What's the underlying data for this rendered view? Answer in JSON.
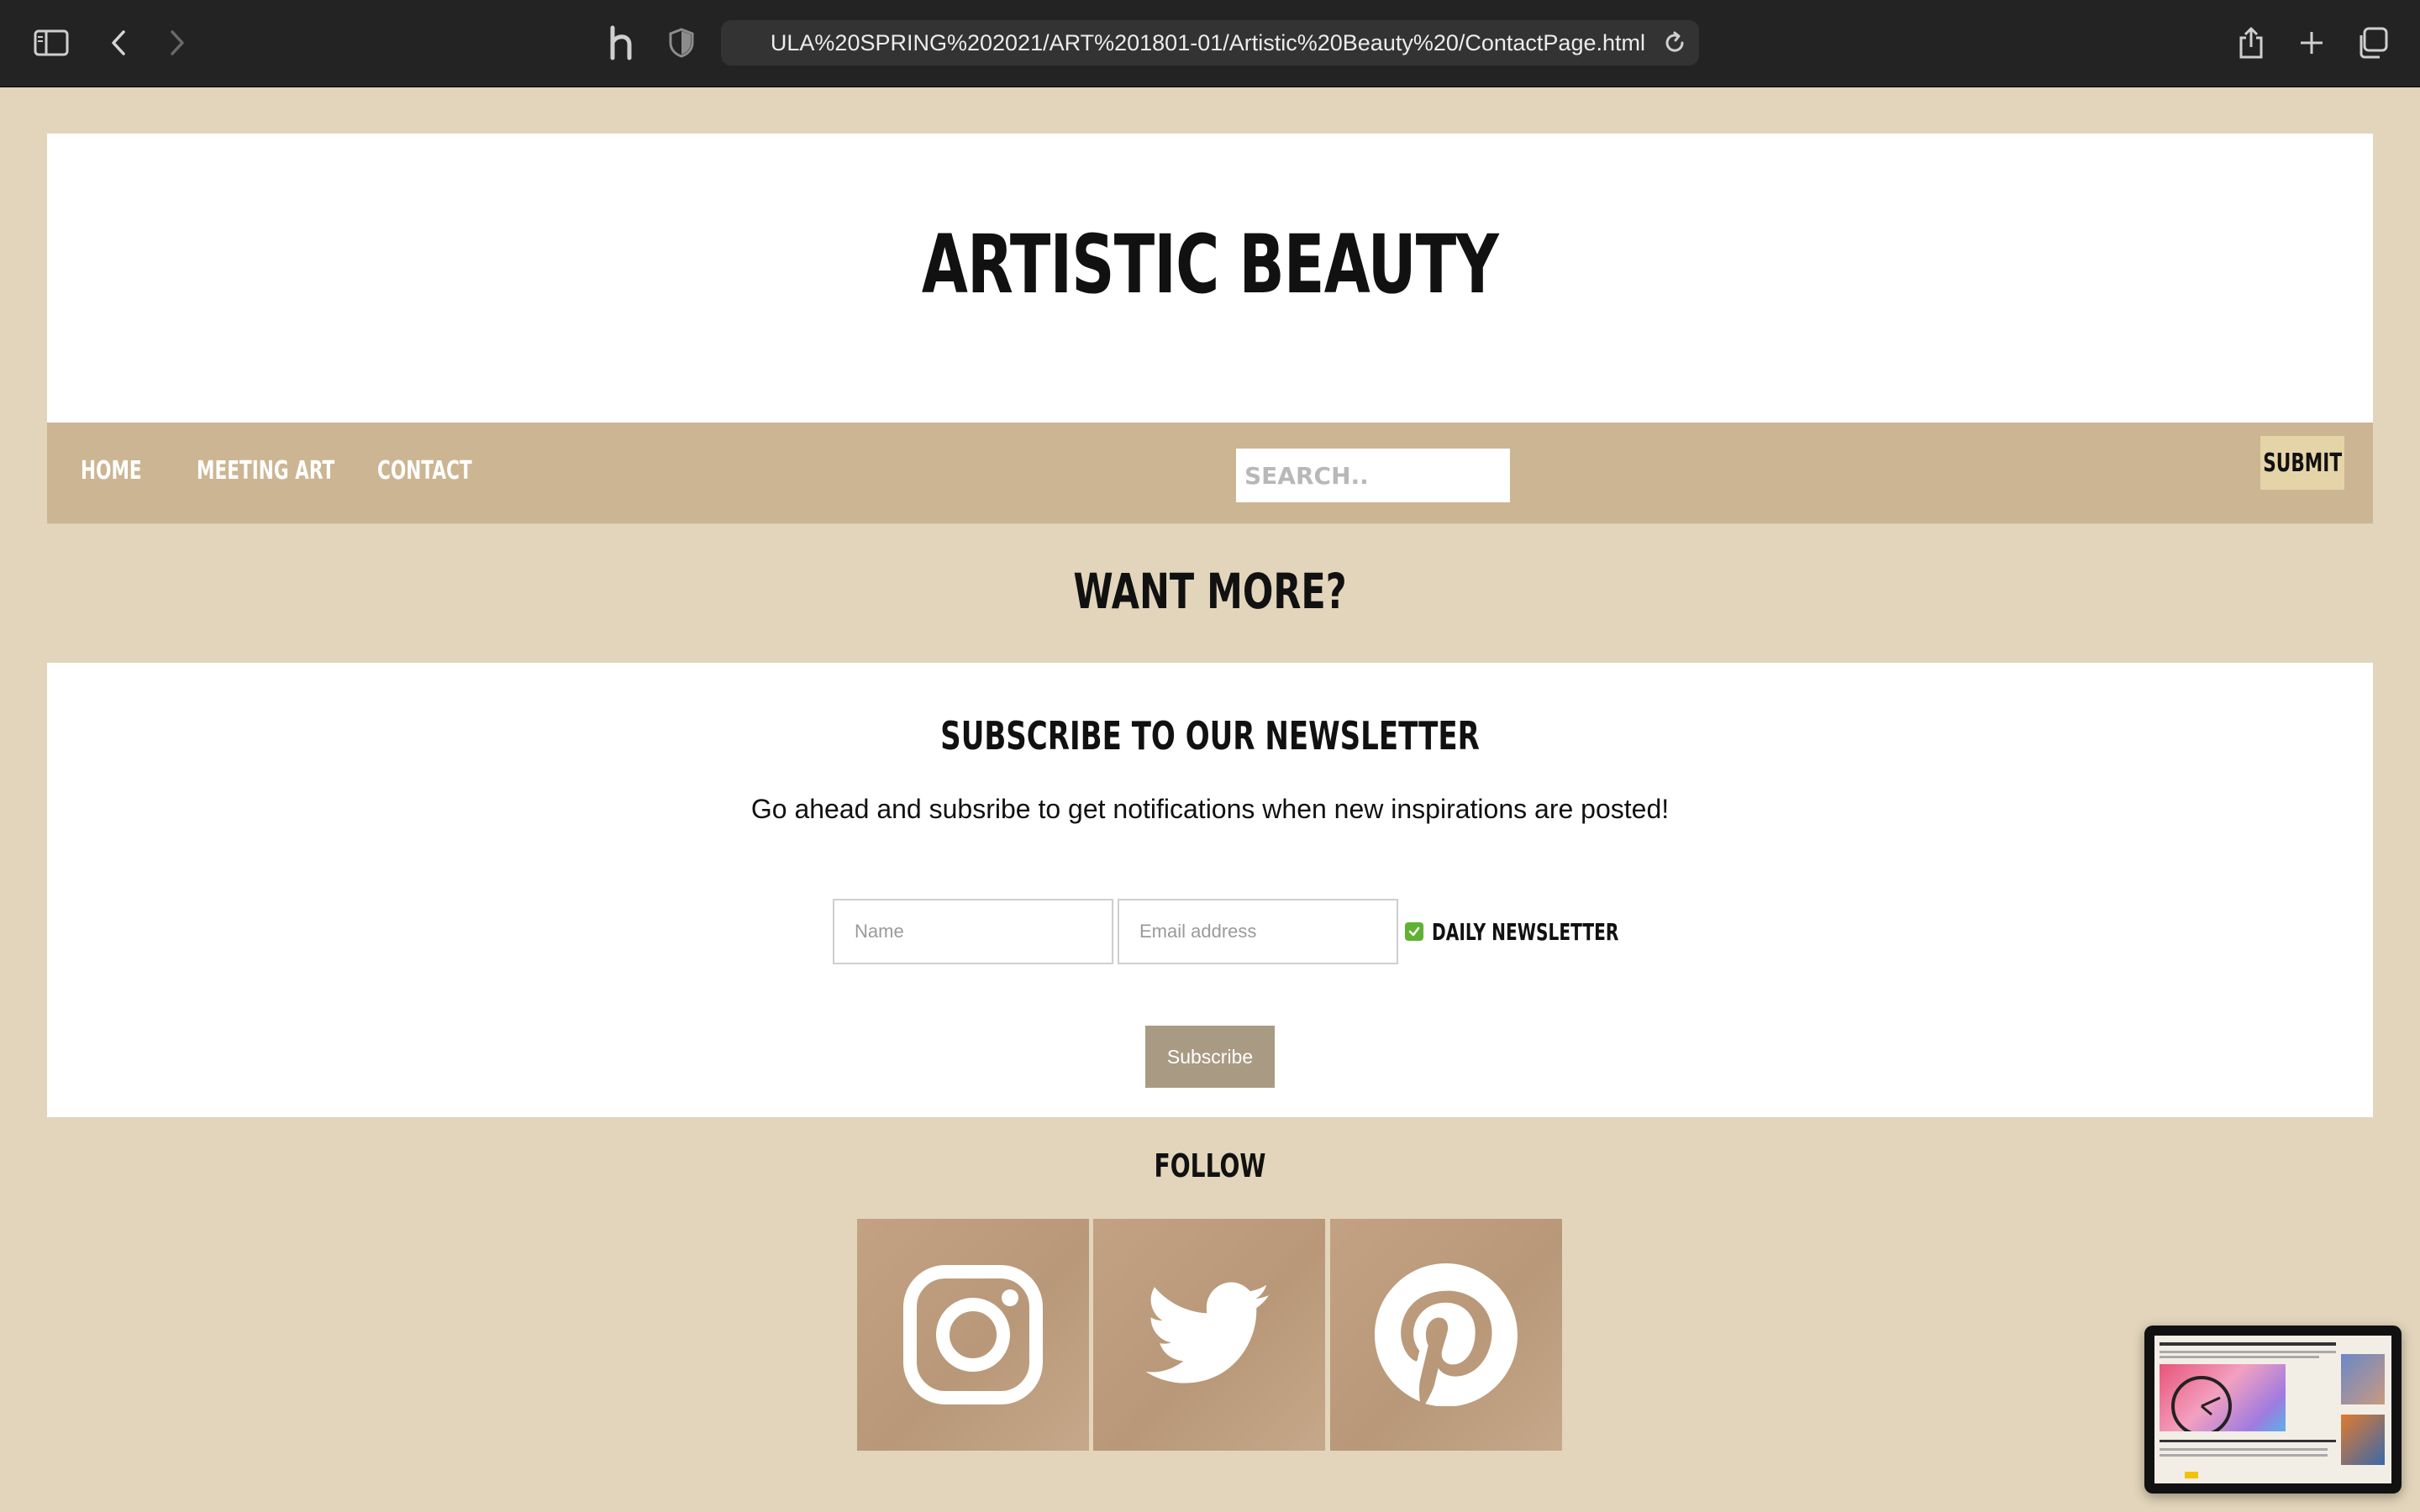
{
  "browser": {
    "url": "ULA%20SPRING%202021/ART%201801-01/Artistic%20Beauty%20/ContactPage.html"
  },
  "site": {
    "title": "ARTISTIC BEAUTY"
  },
  "nav": {
    "items": [
      {
        "label": "HOME"
      },
      {
        "label": "MEETING ART"
      },
      {
        "label": "CONTACT"
      }
    ],
    "search_placeholder": "SEARCH..",
    "submit_label": "SUBMIT"
  },
  "want_more": "WANT MORE?",
  "newsletter": {
    "title": "SUBSCRIBE TO OUR NEWSLETTER",
    "description": "Go ahead and subsribe to get notifications when new inspirations are posted!",
    "name_placeholder": "Name",
    "email_placeholder": "Email address",
    "daily_label": "DAILY NEWSLETTER",
    "daily_checked": true,
    "subscribe_label": "Subscribe"
  },
  "follow": {
    "title": "FOLLOW",
    "icons": [
      "instagram-icon",
      "twitter-icon",
      "pinterest-icon"
    ]
  },
  "colors": {
    "page_bg": "#e2d5bb",
    "nav_bg": "#ccb592",
    "submit_bg": "#e6d4a9",
    "subscribe_bg": "#a99a84",
    "checkbox": "#5fb234"
  }
}
